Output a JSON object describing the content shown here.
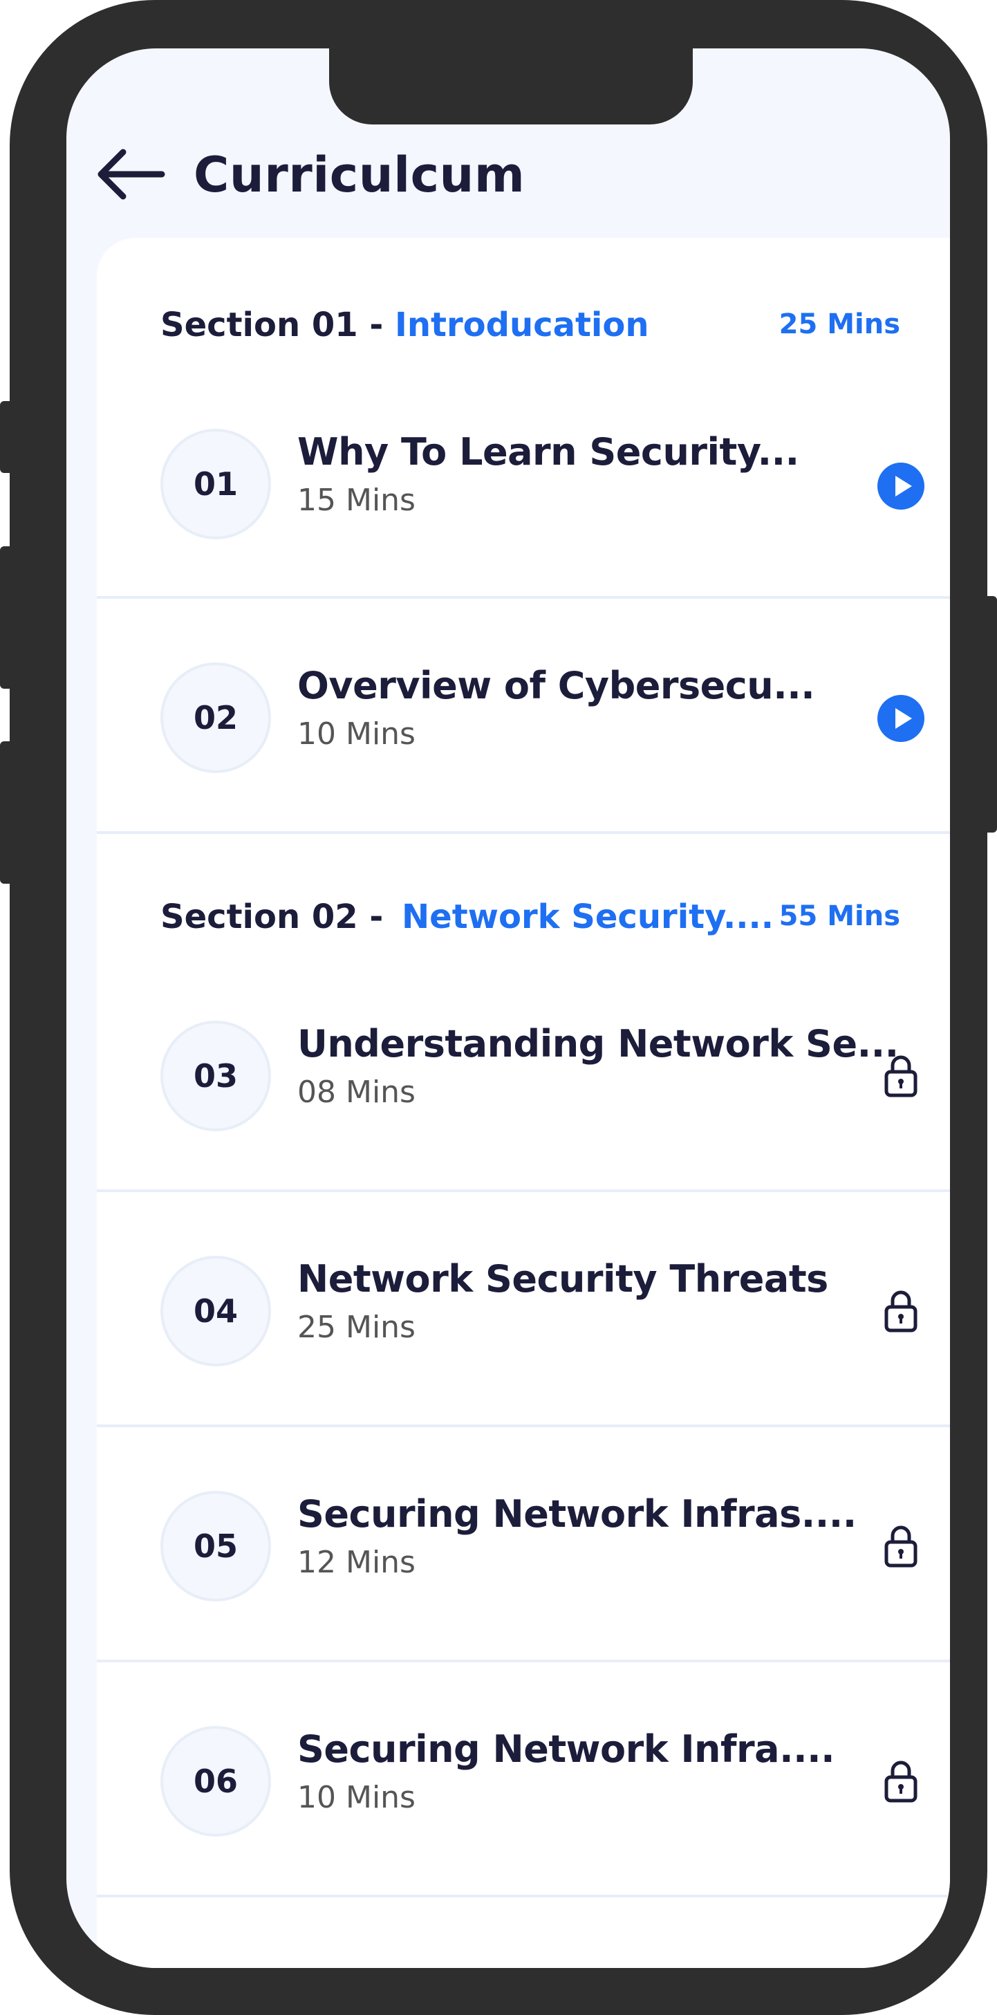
{
  "header": {
    "title": "Curriculcum"
  },
  "sections": [
    {
      "label": "Section 01 -",
      "name": "Introducation",
      "duration": "25 Mins",
      "lessons": [
        {
          "num": "01",
          "title": "Why To Learn Security...",
          "duration": "15 Mins",
          "status": "play"
        },
        {
          "num": "02",
          "title": "Overview of Cybersecu...",
          "duration": "10 Mins",
          "status": "play"
        }
      ]
    },
    {
      "label": "Section 02 -",
      "name": "Network Security....",
      "duration": "55 Mins",
      "lessons": [
        {
          "num": "03",
          "title": "Understanding Network Se...",
          "duration": "08 Mins",
          "status": "locked"
        },
        {
          "num": "04",
          "title": "Network Security Threats",
          "duration": "25 Mins",
          "status": "locked"
        },
        {
          "num": "05",
          "title": "Securing Network Infras....",
          "duration": "12 Mins",
          "status": "locked"
        },
        {
          "num": "06",
          "title": "Securing Network Infra....",
          "duration": "10 Mins",
          "status": "locked"
        }
      ]
    }
  ],
  "icons": {
    "back": "arrow-left-icon",
    "play": "play-icon",
    "lock": "lock-icon"
  },
  "colors": {
    "accent": "#1e6ff2",
    "text": "#1c1d3a",
    "background": "#f4f7fd",
    "frame": "#2e2e2e"
  }
}
